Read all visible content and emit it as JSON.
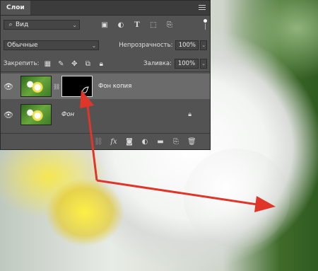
{
  "panel": {
    "tab_label": "Слои",
    "filter": {
      "value": "Вид",
      "icons": [
        "image-filter-icon",
        "adjustment-filter-icon",
        "type-filter-icon",
        "shape-filter-icon",
        "smartobject-filter-icon",
        "filter-toggle-icon"
      ]
    },
    "blend_mode": "Обычные",
    "opacity_label": "Непрозрачность:",
    "opacity_value": "100%",
    "lock_label": "Закрепить:",
    "fill_label": "Заливка:",
    "fill_value": "100%",
    "layers": [
      {
        "name": "Фон копия",
        "selected": true,
        "has_mask": true
      },
      {
        "name": "Фон",
        "selected": false,
        "locked": true
      }
    ]
  },
  "colors": {
    "panel_bg": "#535353",
    "titlebar_bg": "#3c3c3c",
    "selected_layer": "#6b6b6b",
    "arrow": "#e0362a"
  }
}
